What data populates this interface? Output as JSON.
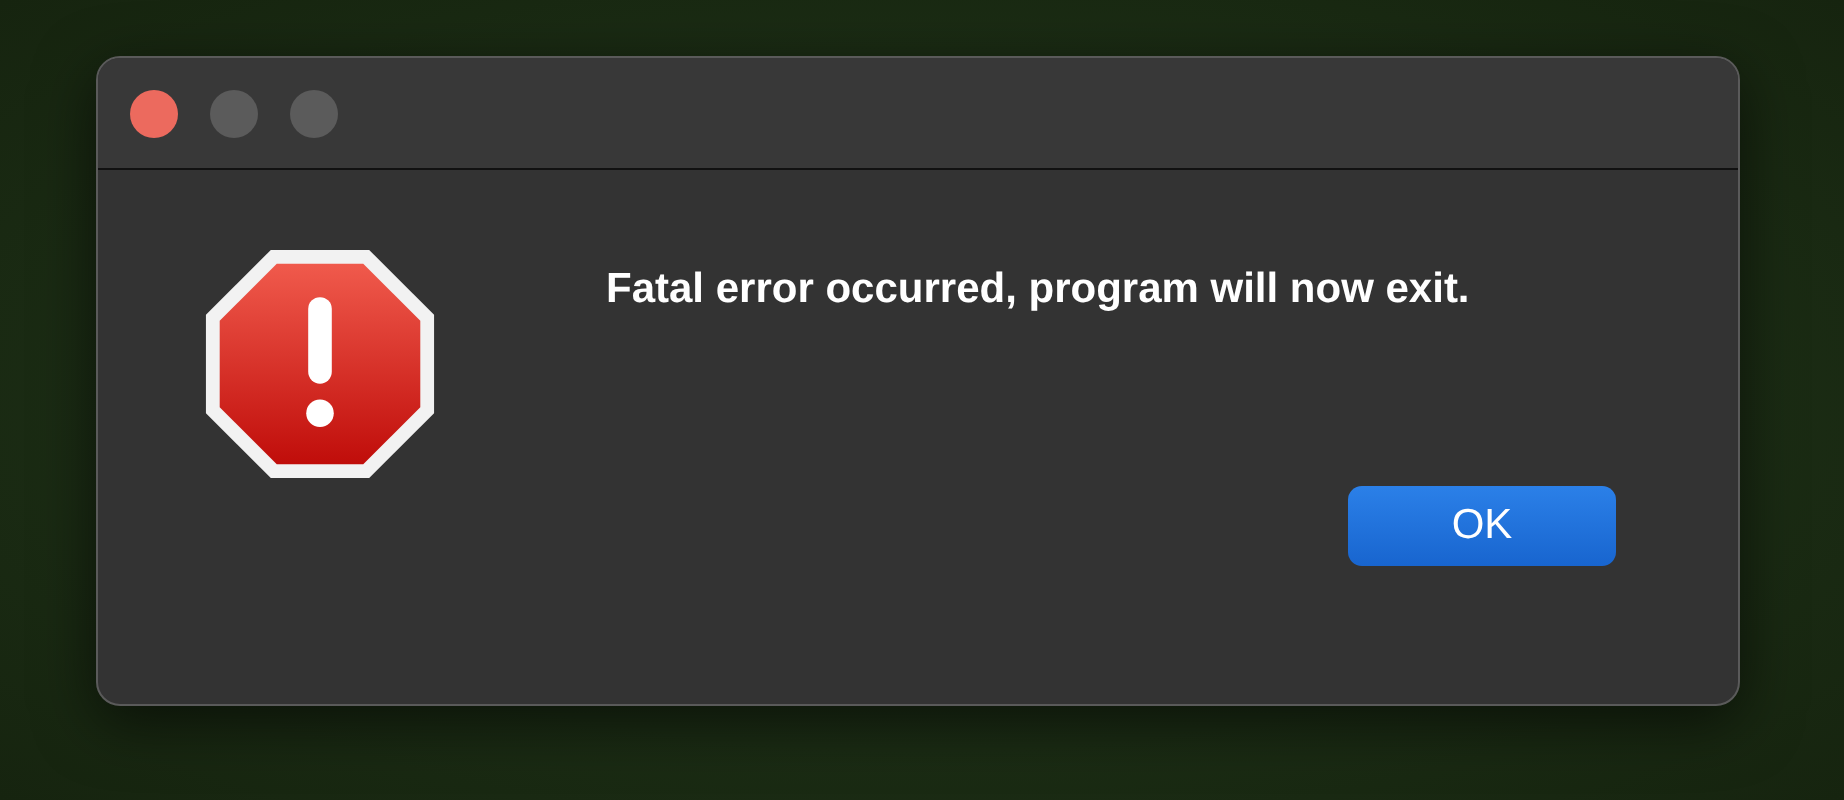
{
  "dialog": {
    "message": "Fatal error occurred, program will now exit.",
    "buttons": [
      {
        "label": "OK",
        "default": true
      }
    ]
  }
}
